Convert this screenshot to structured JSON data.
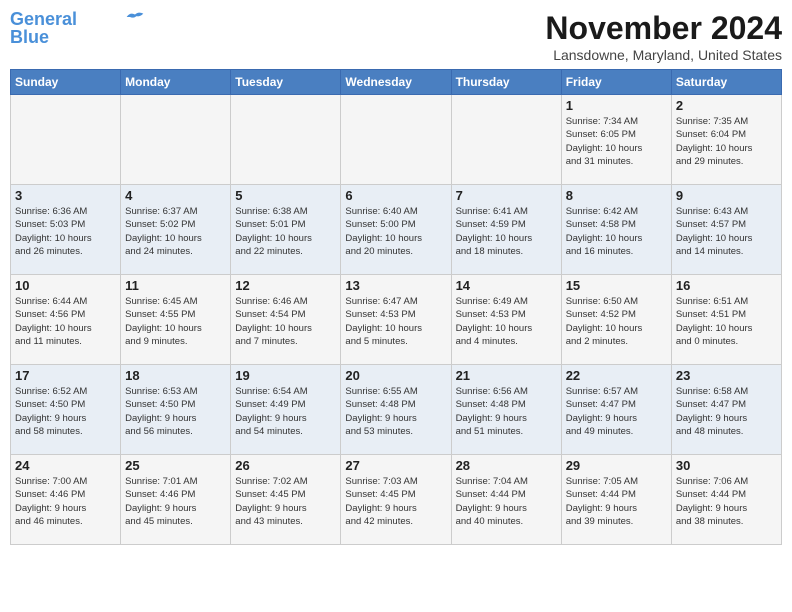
{
  "header": {
    "logo_line1": "General",
    "logo_line2": "Blue",
    "month": "November 2024",
    "location": "Lansdowne, Maryland, United States"
  },
  "days_of_week": [
    "Sunday",
    "Monday",
    "Tuesday",
    "Wednesday",
    "Thursday",
    "Friday",
    "Saturday"
  ],
  "weeks": [
    [
      {
        "day": "",
        "info": ""
      },
      {
        "day": "",
        "info": ""
      },
      {
        "day": "",
        "info": ""
      },
      {
        "day": "",
        "info": ""
      },
      {
        "day": "",
        "info": ""
      },
      {
        "day": "1",
        "info": "Sunrise: 7:34 AM\nSunset: 6:05 PM\nDaylight: 10 hours\nand 31 minutes."
      },
      {
        "day": "2",
        "info": "Sunrise: 7:35 AM\nSunset: 6:04 PM\nDaylight: 10 hours\nand 29 minutes."
      }
    ],
    [
      {
        "day": "3",
        "info": "Sunrise: 6:36 AM\nSunset: 5:03 PM\nDaylight: 10 hours\nand 26 minutes."
      },
      {
        "day": "4",
        "info": "Sunrise: 6:37 AM\nSunset: 5:02 PM\nDaylight: 10 hours\nand 24 minutes."
      },
      {
        "day": "5",
        "info": "Sunrise: 6:38 AM\nSunset: 5:01 PM\nDaylight: 10 hours\nand 22 minutes."
      },
      {
        "day": "6",
        "info": "Sunrise: 6:40 AM\nSunset: 5:00 PM\nDaylight: 10 hours\nand 20 minutes."
      },
      {
        "day": "7",
        "info": "Sunrise: 6:41 AM\nSunset: 4:59 PM\nDaylight: 10 hours\nand 18 minutes."
      },
      {
        "day": "8",
        "info": "Sunrise: 6:42 AM\nSunset: 4:58 PM\nDaylight: 10 hours\nand 16 minutes."
      },
      {
        "day": "9",
        "info": "Sunrise: 6:43 AM\nSunset: 4:57 PM\nDaylight: 10 hours\nand 14 minutes."
      }
    ],
    [
      {
        "day": "10",
        "info": "Sunrise: 6:44 AM\nSunset: 4:56 PM\nDaylight: 10 hours\nand 11 minutes."
      },
      {
        "day": "11",
        "info": "Sunrise: 6:45 AM\nSunset: 4:55 PM\nDaylight: 10 hours\nand 9 minutes."
      },
      {
        "day": "12",
        "info": "Sunrise: 6:46 AM\nSunset: 4:54 PM\nDaylight: 10 hours\nand 7 minutes."
      },
      {
        "day": "13",
        "info": "Sunrise: 6:47 AM\nSunset: 4:53 PM\nDaylight: 10 hours\nand 5 minutes."
      },
      {
        "day": "14",
        "info": "Sunrise: 6:49 AM\nSunset: 4:53 PM\nDaylight: 10 hours\nand 4 minutes."
      },
      {
        "day": "15",
        "info": "Sunrise: 6:50 AM\nSunset: 4:52 PM\nDaylight: 10 hours\nand 2 minutes."
      },
      {
        "day": "16",
        "info": "Sunrise: 6:51 AM\nSunset: 4:51 PM\nDaylight: 10 hours\nand 0 minutes."
      }
    ],
    [
      {
        "day": "17",
        "info": "Sunrise: 6:52 AM\nSunset: 4:50 PM\nDaylight: 9 hours\nand 58 minutes."
      },
      {
        "day": "18",
        "info": "Sunrise: 6:53 AM\nSunset: 4:50 PM\nDaylight: 9 hours\nand 56 minutes."
      },
      {
        "day": "19",
        "info": "Sunrise: 6:54 AM\nSunset: 4:49 PM\nDaylight: 9 hours\nand 54 minutes."
      },
      {
        "day": "20",
        "info": "Sunrise: 6:55 AM\nSunset: 4:48 PM\nDaylight: 9 hours\nand 53 minutes."
      },
      {
        "day": "21",
        "info": "Sunrise: 6:56 AM\nSunset: 4:48 PM\nDaylight: 9 hours\nand 51 minutes."
      },
      {
        "day": "22",
        "info": "Sunrise: 6:57 AM\nSunset: 4:47 PM\nDaylight: 9 hours\nand 49 minutes."
      },
      {
        "day": "23",
        "info": "Sunrise: 6:58 AM\nSunset: 4:47 PM\nDaylight: 9 hours\nand 48 minutes."
      }
    ],
    [
      {
        "day": "24",
        "info": "Sunrise: 7:00 AM\nSunset: 4:46 PM\nDaylight: 9 hours\nand 46 minutes."
      },
      {
        "day": "25",
        "info": "Sunrise: 7:01 AM\nSunset: 4:46 PM\nDaylight: 9 hours\nand 45 minutes."
      },
      {
        "day": "26",
        "info": "Sunrise: 7:02 AM\nSunset: 4:45 PM\nDaylight: 9 hours\nand 43 minutes."
      },
      {
        "day": "27",
        "info": "Sunrise: 7:03 AM\nSunset: 4:45 PM\nDaylight: 9 hours\nand 42 minutes."
      },
      {
        "day": "28",
        "info": "Sunrise: 7:04 AM\nSunset: 4:44 PM\nDaylight: 9 hours\nand 40 minutes."
      },
      {
        "day": "29",
        "info": "Sunrise: 7:05 AM\nSunset: 4:44 PM\nDaylight: 9 hours\nand 39 minutes."
      },
      {
        "day": "30",
        "info": "Sunrise: 7:06 AM\nSunset: 4:44 PM\nDaylight: 9 hours\nand 38 minutes."
      }
    ]
  ]
}
